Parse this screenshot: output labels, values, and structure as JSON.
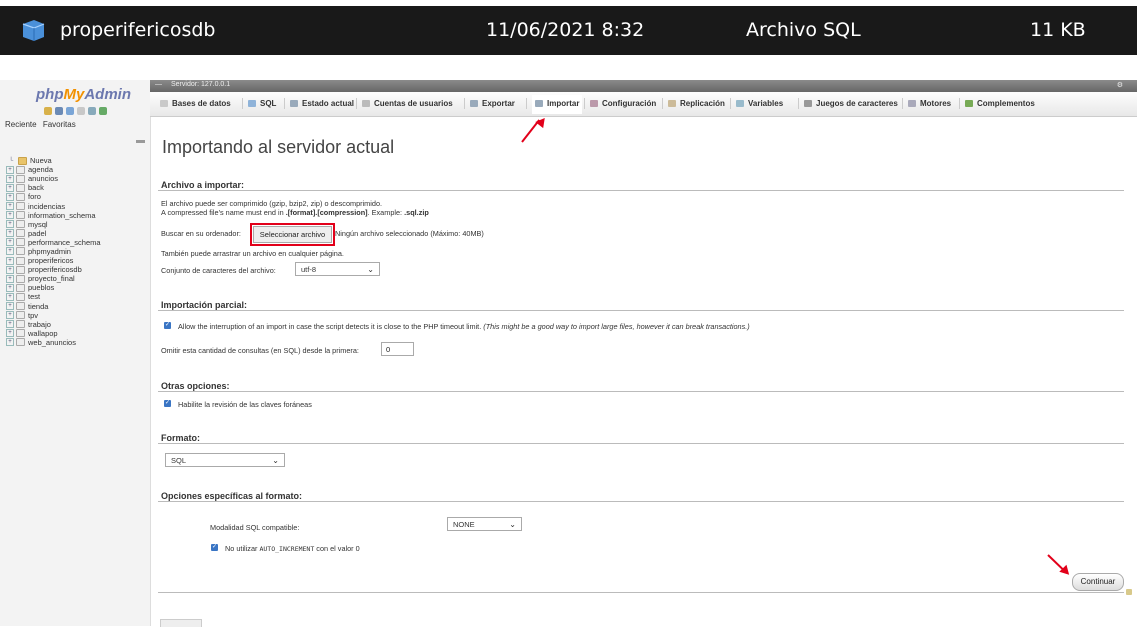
{
  "file_row": {
    "name": "properifericosdb",
    "date": "11/06/2021 8:32",
    "type": "Archivo SQL",
    "size": "11 KB"
  },
  "nav": {
    "logo_php": "php",
    "logo_my": "My",
    "logo_admin": "Admin",
    "tab_recent": "Reciente",
    "tab_favorites": "Favoritas",
    "new_label": "Nueva",
    "databases": [
      "agenda",
      "anuncios",
      "back",
      "foro",
      "incidencias",
      "information_schema",
      "mysql",
      "padel",
      "performance_schema",
      "phpmyadmin",
      "properifericos",
      "properifericosdb",
      "proyecto_final",
      "pueblos",
      "test",
      "tienda",
      "tpv",
      "trabajo",
      "wallapop",
      "web_anuncios"
    ]
  },
  "server_strip": {
    "server": "Servidor: 127.0.0.1"
  },
  "tabs": [
    {
      "label": "Bases de datos",
      "icon": "database-icon",
      "color": "#c9c9c9"
    },
    {
      "label": "SQL",
      "icon": "sql-icon",
      "color": "#8fb3d9"
    },
    {
      "label": "Estado actual",
      "icon": "status-icon",
      "color": "#9ab"
    },
    {
      "label": "Cuentas de usuarios",
      "icon": "users-icon",
      "color": "#bbb"
    },
    {
      "label": "Exportar",
      "icon": "export-icon",
      "color": "#9ab"
    },
    {
      "label": "Importar",
      "icon": "import-icon",
      "color": "#9ab"
    },
    {
      "label": "Configuración",
      "icon": "wrench-icon",
      "color": "#b9a"
    },
    {
      "label": "Replicación",
      "icon": "replication-icon",
      "color": "#cb9"
    },
    {
      "label": "Variables",
      "icon": "variables-icon",
      "color": "#9bc"
    },
    {
      "label": "Juegos de caracteres",
      "icon": "charset-icon",
      "color": "#999"
    },
    {
      "label": "Motores",
      "icon": "engines-icon",
      "color": "#aab"
    },
    {
      "label": "Complementos",
      "icon": "plugins-icon",
      "color": "#7a5"
    }
  ],
  "page": {
    "title": "Importando al servidor actual",
    "file_section": {
      "legend": "Archivo a importar:",
      "line1": "El archivo puede ser comprimido (gzip, bzip2, zip) o descomprimido.",
      "line2_a": "A compressed file's name must end in ",
      "line2_b": ".[format].[compression]",
      "line2_c": ". Example: ",
      "line2_d": ".sql.zip",
      "browse_label": "Buscar en su ordenador:",
      "browse_button": "Seleccionar archivo",
      "no_file": "Ningún archivo seleccionado",
      "max": "(Máximo: 40MB)",
      "drag_hint": "También puede arrastrar un archivo en cualquier página.",
      "charset_label": "Conjunto de caracteres del archivo:",
      "charset_value": "utf-8"
    },
    "partial_section": {
      "legend": "Importación parcial:",
      "allow_interrupt": "Allow the interruption of an import in case the script detects it is close to the PHP timeout limit.",
      "allow_interrupt_note": "(This might be a good way to import large files, however it can break transactions.)",
      "skip_label": "Omitir esta cantidad de consultas (en SQL) desde la primera:",
      "skip_value": "0"
    },
    "other_section": {
      "legend": "Otras opciones:",
      "fk_checks": "Habilite la revisión de las claves foráneas"
    },
    "format_section": {
      "legend": "Formato:",
      "format_value": "SQL"
    },
    "format_options_section": {
      "legend": "Opciones específicas al formato:",
      "compat_label": "Modalidad SQL compatible:",
      "compat_value": "NONE",
      "no_auto_a": "No utilizar ",
      "no_auto_code": "AUTO_INCREMENT",
      "no_auto_b": " con el valor 0"
    },
    "continue_button": "Continuar"
  },
  "colors": {
    "annotation": "#e2001a",
    "checkbox": "#3a75c4"
  }
}
